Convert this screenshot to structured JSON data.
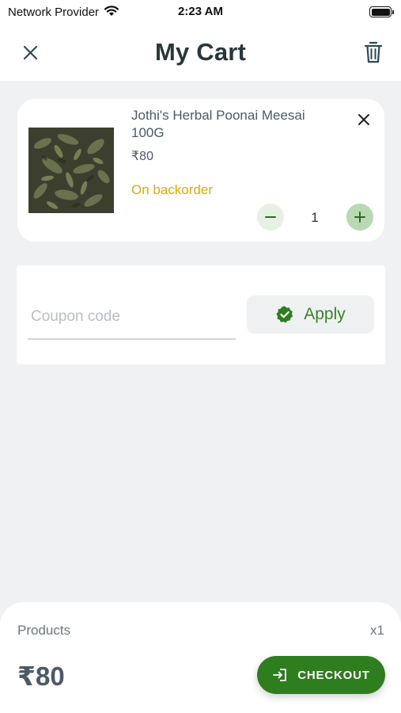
{
  "status_bar": {
    "carrier": "Network Provider",
    "time": "2:23 AM"
  },
  "header": {
    "title": "My Cart",
    "close_icon": "close-icon",
    "trash_icon": "trash-icon"
  },
  "cart": {
    "items": [
      {
        "name": "Jothi's  Herbal Poonai Meesai 100G",
        "price": "₹80",
        "stock_status": "On backorder",
        "quantity": "1"
      }
    ]
  },
  "coupon": {
    "placeholder": "Coupon code",
    "value": "",
    "apply_label": "Apply"
  },
  "summary": {
    "products_label": "Products",
    "products_count": "x1",
    "total": "₹80",
    "checkout_label": "CHECKOUT"
  },
  "colors": {
    "accent_green": "#2e7d1e",
    "stock_yellow": "#e8a800",
    "background": "#f0f1f3"
  }
}
